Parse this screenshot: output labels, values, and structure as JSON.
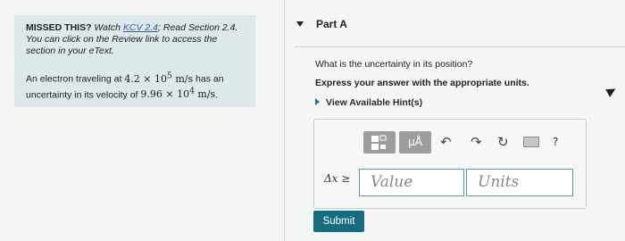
{
  "left": {
    "missed_lead": "MISSED THIS?",
    "missed_watch": " Watch ",
    "missed_link": "KCV 2.4",
    "missed_rest": "; Read Section 2.4. You can click on the Review link to access the section in your eText.",
    "problem_text_1": "An electron traveling at ",
    "speed": "4.2 × 10",
    "speed_exp": "5",
    "speed_unit": " m/s",
    "problem_text_2": " has an uncertainty in its velocity of ",
    "velocity_unc": "9.96 × 10",
    "velocity_exp": "4",
    "velocity_unit": " m/s",
    "period": "."
  },
  "part": {
    "title": "Part A"
  },
  "question": "What is the uncertainty in its position?",
  "instruction": "Express your answer with the appropriate units.",
  "hint_label": "View Available Hint(s)",
  "toolbar": {
    "mu_label": "μÅ",
    "undo_glyph": "↶",
    "redo_glyph": "↷",
    "reset_glyph": "↻",
    "help_glyph": "?"
  },
  "answer": {
    "variable_label": "Δx ≥",
    "value_placeholder": "Value",
    "units_placeholder": "Units"
  },
  "submit_label": "Submit"
}
